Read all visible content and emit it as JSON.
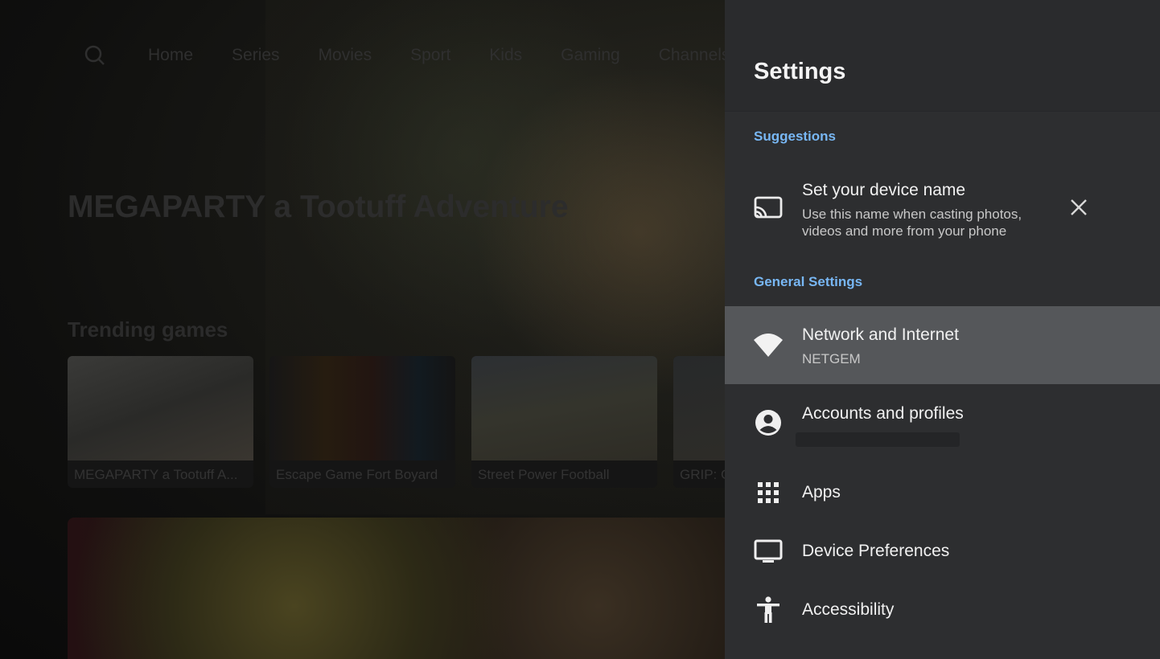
{
  "background": {
    "nav": {
      "search_icon": "search-icon",
      "items": [
        "Home",
        "Series",
        "Movies",
        "Sport",
        "Kids",
        "Gaming",
        "Channels"
      ]
    },
    "hero_title": "MEGAPARTY a Tootuff Adventure",
    "row_title": "Trending games",
    "cards": [
      {
        "title": "MEGAPARTY a Tootuff A..."
      },
      {
        "title": "Escape Game Fort Boyard"
      },
      {
        "title": "Street Power Football"
      },
      {
        "title": "GRIP: C"
      }
    ]
  },
  "settings": {
    "title": "Settings",
    "suggestions_label": "Suggestions",
    "suggestion": {
      "icon": "cast-icon",
      "title": "Set your device name",
      "subtitle": "Use this name when casting photos, videos and more from your phone",
      "dismiss_icon": "close-icon"
    },
    "general_label": "General Settings",
    "items": [
      {
        "icon": "wifi-icon",
        "title": "Network and Internet",
        "subtitle": "NETGEM"
      },
      {
        "icon": "account-icon",
        "title": "Accounts and profiles",
        "subtitle": ""
      },
      {
        "icon": "apps-grid-icon",
        "title": "Apps"
      },
      {
        "icon": "tv-icon",
        "title": "Device Preferences"
      },
      {
        "icon": "accessibility-icon",
        "title": "Accessibility"
      }
    ]
  },
  "colors": {
    "panel_bg": "#2d2e30",
    "section_accent": "#78b7f4",
    "focused_row": "#55575a",
    "text_primary": "#f1f1f1"
  }
}
